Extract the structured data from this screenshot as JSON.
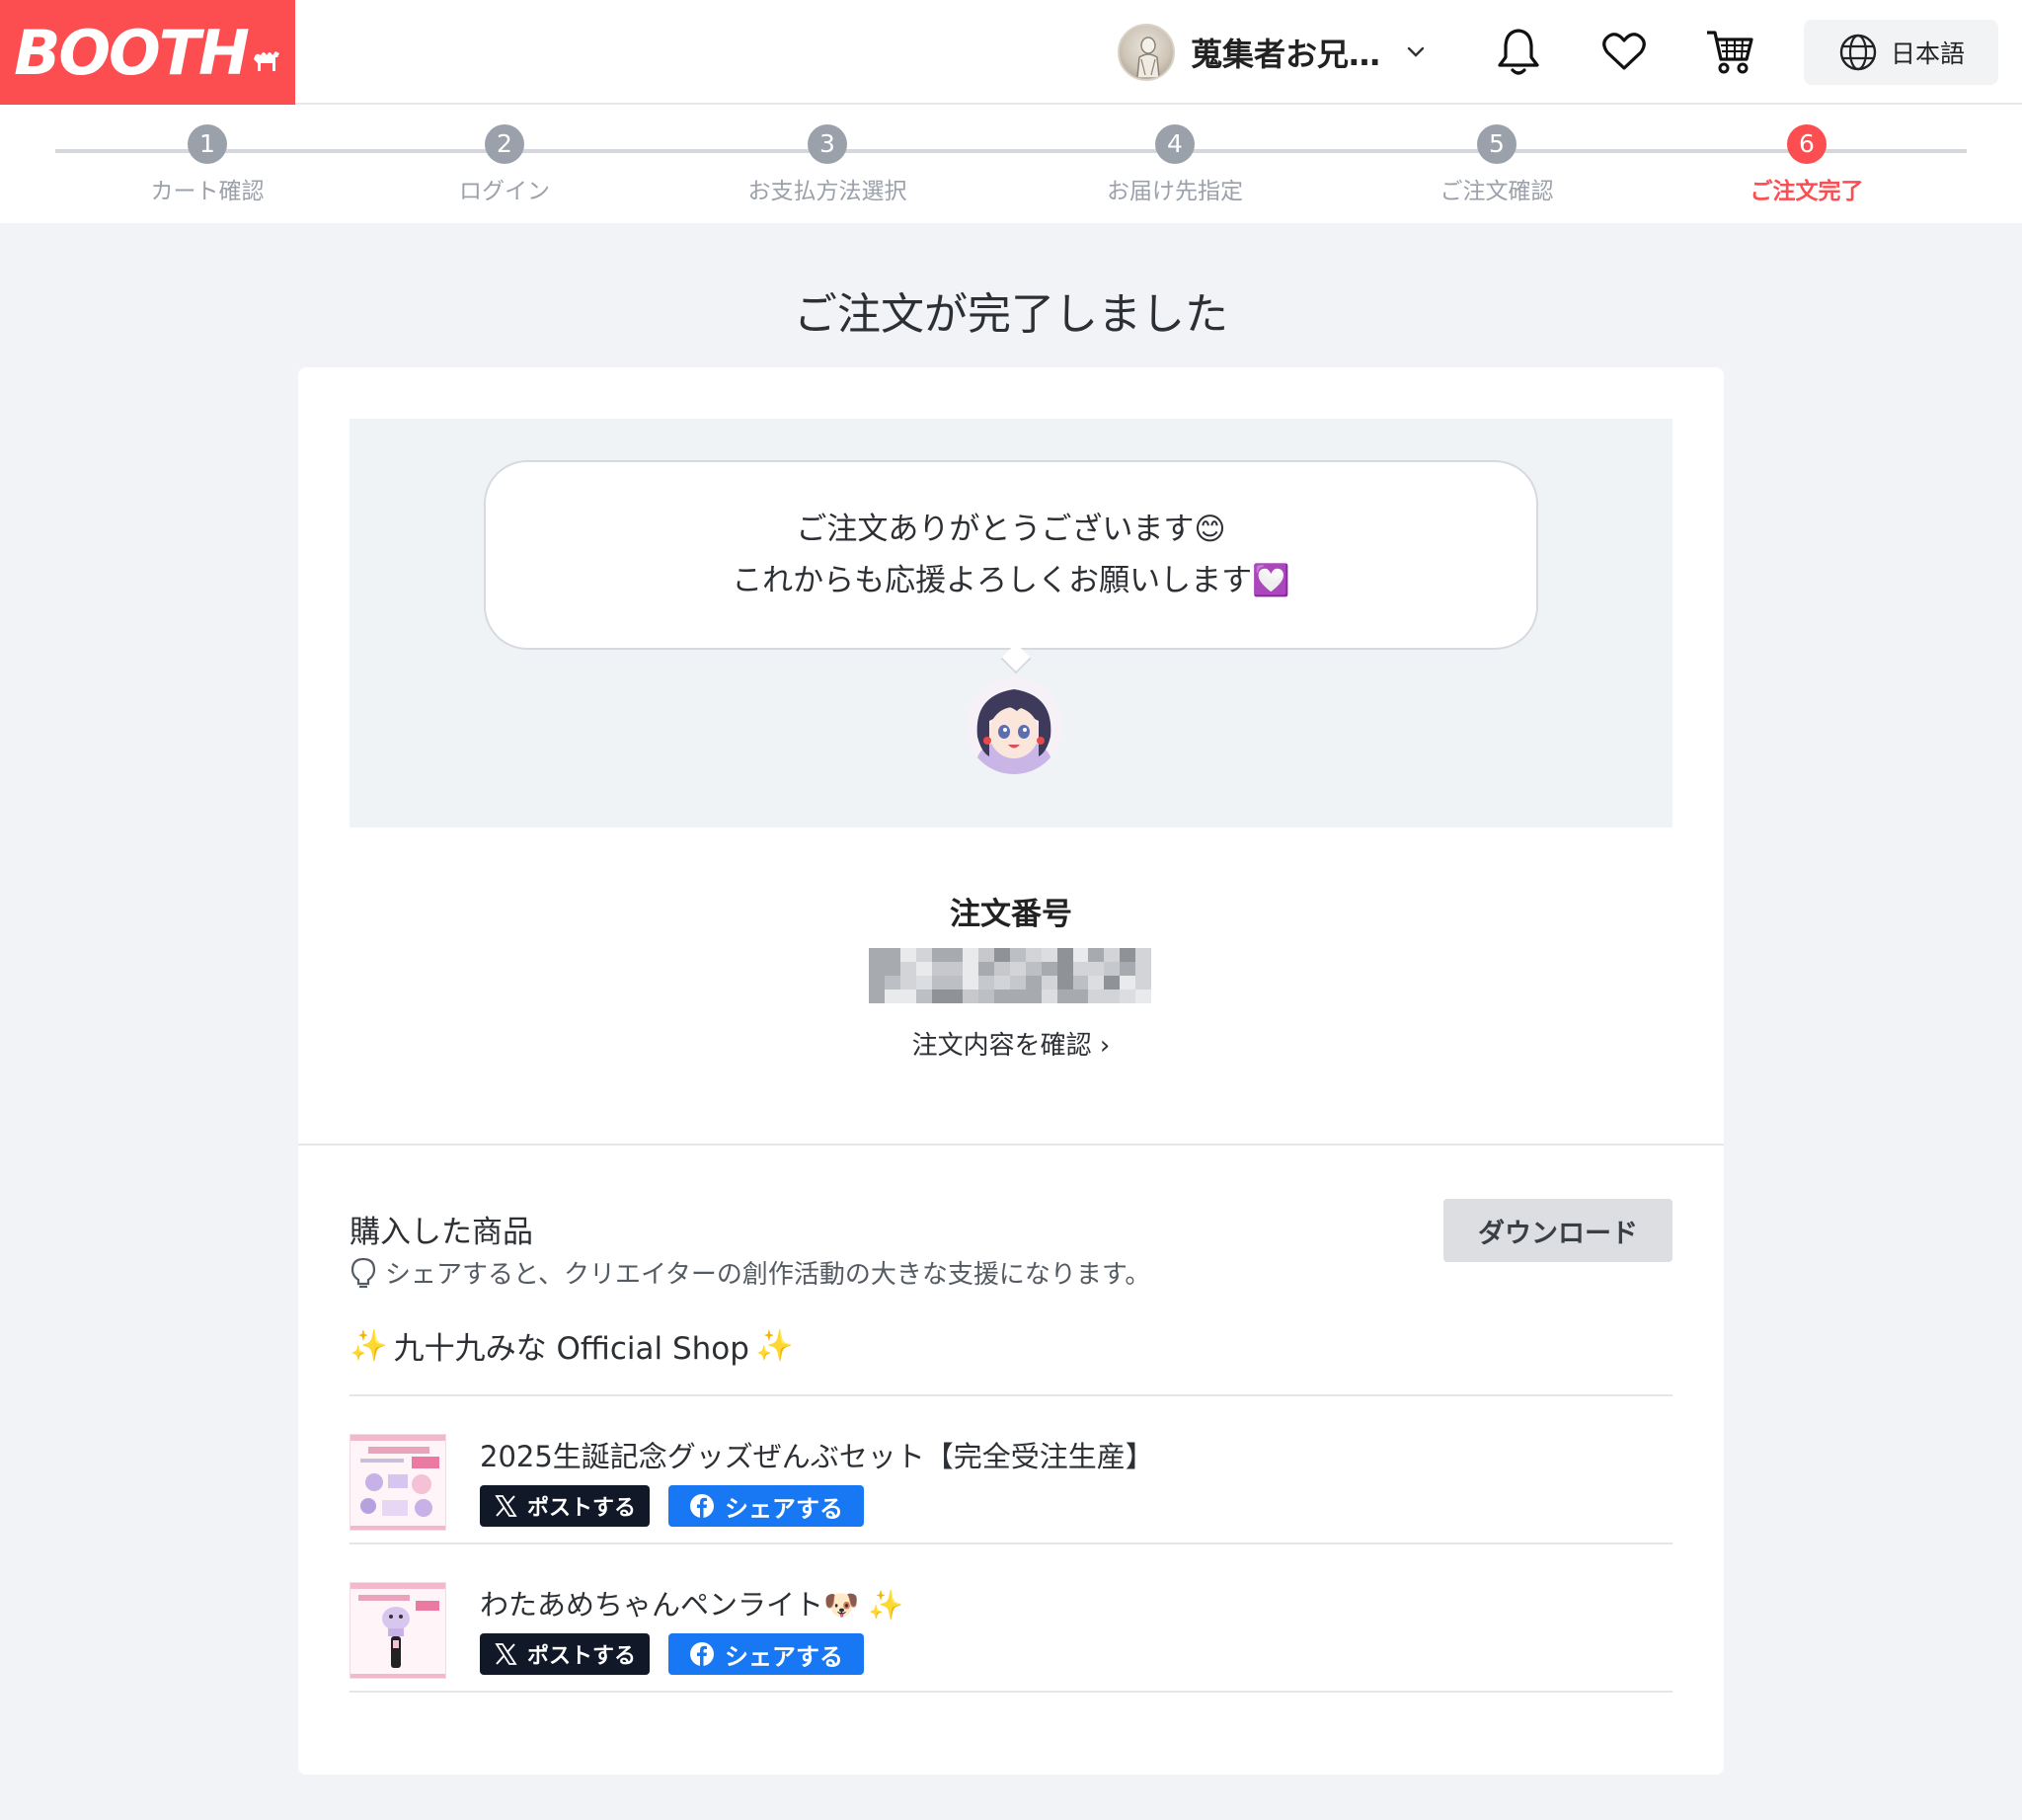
{
  "header": {
    "logo_text": "BOOTH",
    "user_name": "蒐集者お兄…",
    "language": "日本語"
  },
  "stepper": {
    "steps": [
      {
        "num": "1",
        "label": "カート確認"
      },
      {
        "num": "2",
        "label": "ログイン"
      },
      {
        "num": "3",
        "label": "お支払方法選択"
      },
      {
        "num": "4",
        "label": "お届け先指定"
      },
      {
        "num": "5",
        "label": "ご注文確認"
      },
      {
        "num": "6",
        "label": "ご注文完了"
      }
    ],
    "active_index": 5
  },
  "page_title": "ご注文が完了しました",
  "message": {
    "line1": "ご注文ありがとうございます😊",
    "line2": "これからも応援よろしくお願いします💟"
  },
  "order": {
    "label": "注文番号",
    "link": "注文内容を確認 ›"
  },
  "purchased": {
    "title": "購入した商品",
    "hint": "シェアすると、クリエイターの創作活動の大きな支援になります。",
    "download_label": "ダウンロード",
    "shop_name": "九十九みな Official Shop",
    "items": [
      {
        "title": "2025生誕記念グッズぜんぶセット【完全受注生産】",
        "post_label": "ポストする",
        "share_label": "シェアする"
      },
      {
        "title": "わたあめちゃんペンライト🐶 ✨",
        "post_label": "ポストする",
        "share_label": "シェアする"
      }
    ]
  },
  "colors": {
    "brand": "#fc4d50",
    "step_inactive": "#9aa1ab",
    "facebook": "#1877f2",
    "x_button": "#111827",
    "page_bg": "#f1f3f6"
  }
}
